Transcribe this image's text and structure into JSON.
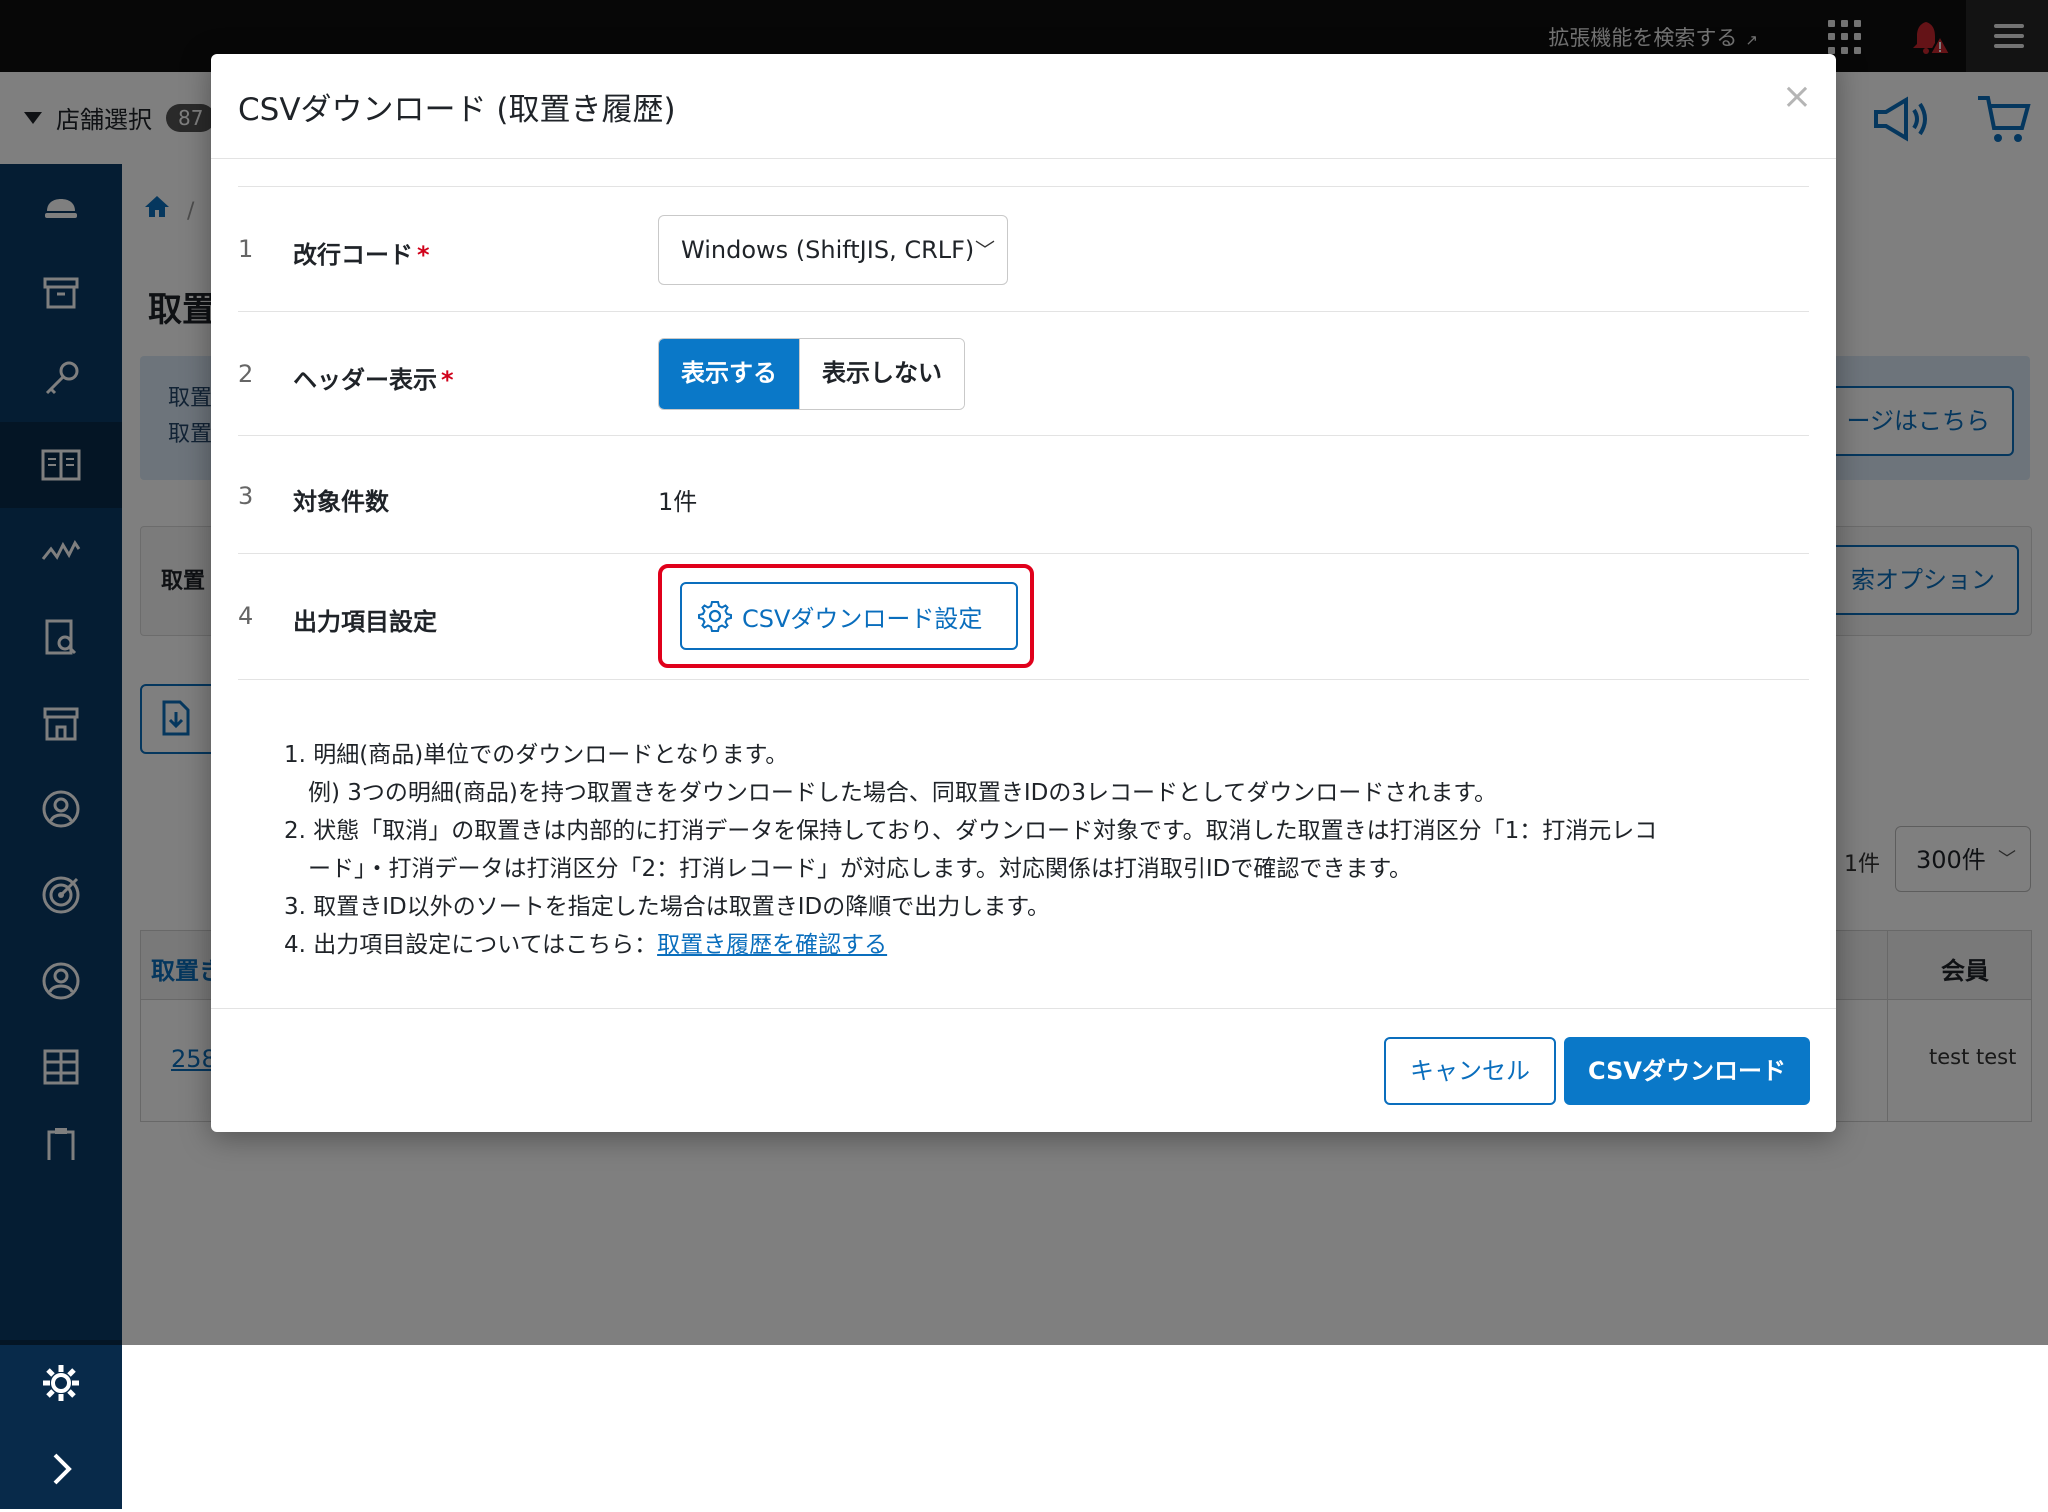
{
  "topbar": {
    "extension_search": "拡張機能を検索する"
  },
  "subbar": {
    "store_select_label": "店舗選択",
    "store_count_badge": "87"
  },
  "background": {
    "breadcrumb_partial": "/",
    "heading_partial": "取置",
    "info_line1_partial": "取置",
    "info_line2_partial": "取置",
    "info_button_partial": "ージはこちら",
    "search_label_partial": "取置",
    "search_option_partial": "索オプション",
    "result_count": "1件",
    "per_page": "300件",
    "table": {
      "col1_header_partial": "取置き",
      "col_member_header": "会員",
      "row1_id_partial": "258",
      "row1_member": "test test"
    }
  },
  "modal": {
    "title": "CSVダウンロード (取置き履歴)",
    "close_symbol": "×",
    "rows": [
      {
        "num": "1",
        "label": "改行コード",
        "required": "*",
        "value": "Windows (ShiftJIS, CRLF)"
      },
      {
        "num": "2",
        "label": "ヘッダー表示",
        "required": "*",
        "option_on": "表示する",
        "option_off": "表示しない"
      },
      {
        "num": "3",
        "label": "対象件数",
        "value": "1件"
      },
      {
        "num": "4",
        "label": "出力項目設定",
        "button": "CSVダウンロード設定"
      }
    ],
    "notes": [
      "1. 明細(商品)単位でのダウンロードとなります。",
      "例) 3つの明細(商品)を持つ取置きをダウンロードした場合、同取置きIDの3レコードとしてダウンロードされます。",
      "2. 状態「取消」の取置きは内部的に打消データを保持しており、ダウンロード対象です。取消した取置きは打消区分「1：打消元レコ",
      "ード」・打消データは打消区分「2：打消レコード」が対応します。対応関係は打消取引IDで確認できます。",
      "3. 取置きID以外のソートを指定した場合は取置きIDの降順で出力します。",
      "4. 出力項目設定についてはこちら："
    ],
    "notes_link": "取置き履歴を確認する",
    "footer": {
      "cancel": "キャンセル",
      "download": "CSVダウンロード"
    }
  },
  "colors": {
    "primary": "#0a78c8",
    "link": "#0a6ebd",
    "sidebar": "#0b3a66",
    "highlight": "#e0001b",
    "required": "#d0021b"
  }
}
